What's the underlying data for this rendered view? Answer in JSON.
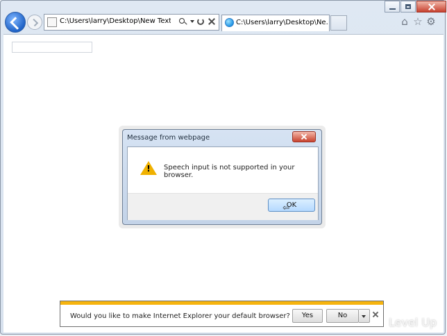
{
  "browser": {
    "address_text": "C:\\Users\\larry\\Desktop\\New Text Docume",
    "tab_title": "C:\\Users\\larry\\Desktop\\Ne..."
  },
  "dialog": {
    "title": "Message from webpage",
    "message": "Speech input is not supported in your browser.",
    "ok_label": "OK"
  },
  "infobar": {
    "question": "Would you like to make Internet Explorer your default browser?",
    "yes_label": "Yes",
    "no_label": "No"
  },
  "watermark": {
    "text": "Level Up"
  },
  "colors": {
    "accent_blue": "#1f63c7",
    "warning": "#f0b100",
    "infobar": "#f6b40e"
  },
  "icons": [
    "back-icon",
    "forward-icon",
    "search-icon",
    "dropdown-icon",
    "refresh-icon",
    "stop-icon",
    "home-icon",
    "favorites-icon",
    "gear-icon",
    "warning-icon",
    "close-icon"
  ]
}
